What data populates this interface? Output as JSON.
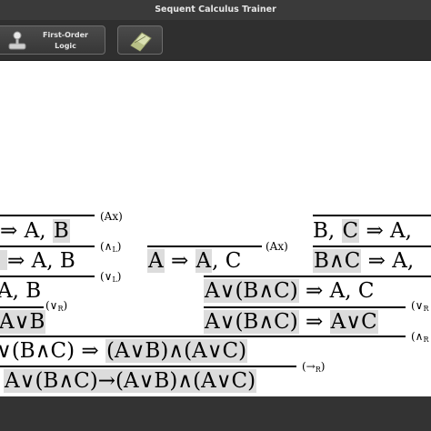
{
  "window": {
    "title": "Sequent Calculus Trainer"
  },
  "toolbar": {
    "logic_button": {
      "label": "First-Order\nLogic",
      "icon": "joystick-icon"
    },
    "tool_button": {
      "icon": "eraser-icon"
    }
  },
  "proof": {
    "top_left": {
      "seq1": {
        "pre": "",
        "arrow": "⇒ A, ",
        "h": "B"
      },
      "seq2": {
        "pre": "",
        "arrow": "⇒ A, B"
      },
      "seq3": {
        "pre": "A, B"
      },
      "seq4": {
        "h": "A∨B"
      }
    },
    "rules": {
      "ax_left": "(Ax)",
      "and_left_a": "(∧",
      "and_left_b": "L",
      "or_left_a": "(∨",
      "or_left_b": "L",
      "or_right_a": "(∨",
      "or_right_b": "R",
      "ax_mid": "(Ax)",
      "impl_right_a": "(→",
      "impl_right_b": "R",
      "right_edge_1": "(∨",
      "right_edge_2": "(∧"
    },
    "mid": {
      "h1": "A",
      "arrow": "⇒",
      "h2": "A",
      "rest": ", C"
    },
    "top_right": {
      "s1_h1": "B",
      "s1_mid": ", ",
      "s1_h2": "C",
      "s1_rest": " ⇒ A,",
      "s2_h": "B∧C",
      "s2_rest": " ⇒ A,"
    },
    "right_mid": {
      "s1_h": "A∨(B∧C)",
      "s1_rest": " ⇒ A, C",
      "s2_h": "A∨(B∧C)",
      "s2_arrow": " ⇒ ",
      "s2_h2": "A∨C"
    },
    "lower": {
      "s1_pre": "∨(B∧C) ⇒ ",
      "s1_h": "(A∨B)∧(A∨C)",
      "s2_h": "A∨(B∧C)→(A∨B)∧(A∨C)"
    }
  },
  "colors": {
    "highlight": "#dcdcdc",
    "titlebar": "#3a3a3a",
    "toolbar": "#2f2f2f"
  }
}
